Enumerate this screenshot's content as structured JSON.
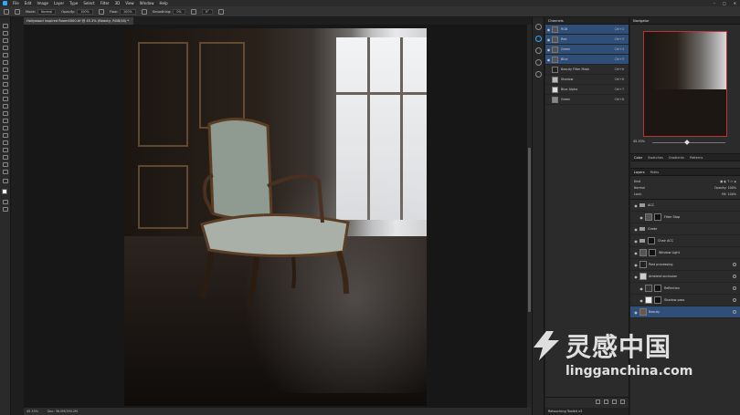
{
  "menubar": {
    "items": [
      "File",
      "Edit",
      "Image",
      "Layer",
      "Type",
      "Select",
      "Filter",
      "3D",
      "View",
      "Window",
      "Help"
    ],
    "window_controls": [
      "–",
      "□",
      "✕"
    ]
  },
  "optionsbar": {
    "mode_label": "Mode:",
    "mode_value": "Normal",
    "opacity_label": "Opacity:",
    "opacity_value": "100%",
    "flow_label": "Flow:",
    "flow_value": "100%",
    "smoothing_label": "Smoothing:",
    "smoothing_value": "0%",
    "angle_value": "0°"
  },
  "document": {
    "tab_title": "Hollywood inspired Room0000.tif @ 45.3% (Beauty, RGB/16) *",
    "status_zoom": "45.33%",
    "status_doc": "Doc: 36.0M/390.2M"
  },
  "channels": {
    "title": "Channels",
    "rows": [
      {
        "name": "RGB",
        "shortcut": "Ctrl+2",
        "selected": true
      },
      {
        "name": "Red",
        "shortcut": "Ctrl+3",
        "selected": true
      },
      {
        "name": "Green",
        "shortcut": "Ctrl+4",
        "selected": true
      },
      {
        "name": "Blue",
        "shortcut": "Ctrl+5",
        "selected": true
      },
      {
        "name": "Beauty Filter Mask",
        "shortcut": "Ctrl+6",
        "selected": false
      },
      {
        "name": "Shadow",
        "shortcut": "Ctrl+6",
        "selected": false
      },
      {
        "name": "Blue Alpha",
        "shortcut": "Ctrl+7",
        "selected": false
      },
      {
        "name": "Green",
        "shortcut": "Ctrl+8",
        "selected": false
      }
    ],
    "bottom_tab": "Retouching Toolkit v3"
  },
  "navigator": {
    "title": "Navigator",
    "zoom": "45.33%"
  },
  "color_tabs": [
    "Color",
    "Swatches",
    "Gradients",
    "Patterns"
  ],
  "layers": {
    "tabs": [
      "Layers",
      "Paths"
    ],
    "filter_label": "Kind",
    "blend_mode": "Normal",
    "opacity_label": "Opacity:",
    "opacity_value": "100%",
    "lock_label": "Lock:",
    "fill_label": "Fill:",
    "fill_value": "100%",
    "rows": [
      {
        "name": "ACC",
        "type": "group"
      },
      {
        "name": "Filter Stop",
        "type": "adjust"
      },
      {
        "name": "Grade",
        "type": "group"
      },
      {
        "name": "Chair ACC",
        "type": "group"
      },
      {
        "name": "Window Light",
        "type": "adjust"
      },
      {
        "name": "Post processing",
        "type": "layer"
      },
      {
        "name": "Ambient occlusion",
        "type": "layer"
      },
      {
        "name": "Reflection",
        "type": "adjust"
      },
      {
        "name": "Shadow pass",
        "type": "adjust"
      },
      {
        "name": "Beauty",
        "type": "layer"
      }
    ]
  },
  "watermark": {
    "cn": "灵感中国",
    "url": "lingganchina.com"
  },
  "colors": {
    "accent": "#31a8ff",
    "selection": "#2f4f79"
  }
}
